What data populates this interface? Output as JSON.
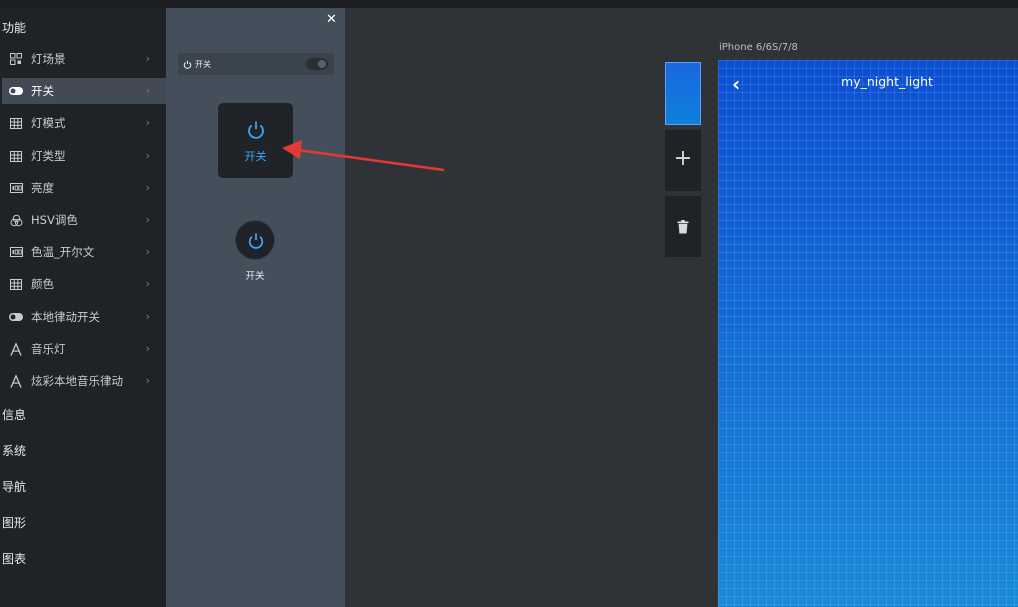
{
  "sidebar": {
    "section_features": "功能",
    "items": [
      {
        "label": "灯场景",
        "icon": "grid-apps-icon"
      },
      {
        "label": "开关",
        "icon": "toggle-icon",
        "active": true
      },
      {
        "label": "灯模式",
        "icon": "table-grid-icon"
      },
      {
        "label": "灯类型",
        "icon": "table-grid-icon"
      },
      {
        "label": "亮度",
        "icon": "number-box-icon"
      },
      {
        "label": "HSV调色",
        "icon": "color-circles-icon"
      },
      {
        "label": "色温_开尔文",
        "icon": "number-box-icon"
      },
      {
        "label": "颜色",
        "icon": "table-grid-icon"
      },
      {
        "label": "本地律动开关",
        "icon": "toggle-icon"
      },
      {
        "label": "音乐灯",
        "icon": "letter-a-icon"
      },
      {
        "label": "炫彩本地音乐律动",
        "icon": "letter-a-icon"
      }
    ],
    "sections": [
      "信息",
      "系统",
      "导航",
      "图形",
      "图表"
    ]
  },
  "panel": {
    "close_label": "✕",
    "toggle_label": "开关",
    "card_button_label": "开关",
    "round_button_label": "开关"
  },
  "thumbs": {
    "add_glyph": "+",
    "delete_icon": "trash-icon"
  },
  "preview": {
    "device": "iPhone 6/6S/7/8",
    "back_glyph": "‹",
    "title": "my_night_light"
  },
  "colors": {
    "accent": "#37a8ff",
    "sidebar_bg": "#202326",
    "panel_bg": "#454f5b",
    "active_item_bg": "#414a55",
    "arrow": "#e53935",
    "phone_top": "#0c4fd2",
    "phone_bottom": "#1a8ad8"
  }
}
